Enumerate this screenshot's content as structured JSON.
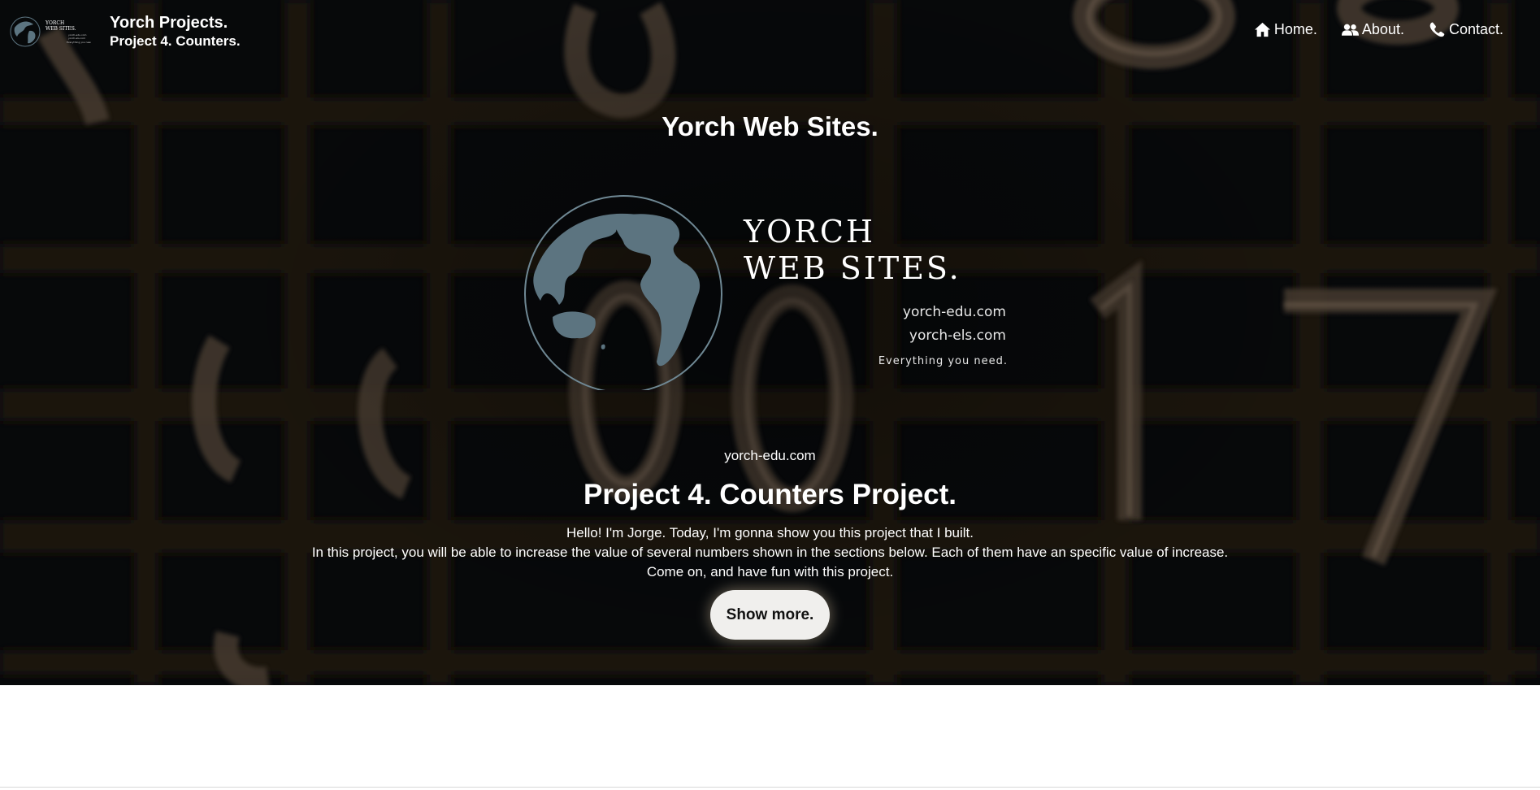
{
  "header": {
    "logo_icon": "yorch-globe-logo",
    "brand_title": "Yorch Projects.",
    "brand_subtitle": "Project 4. Counters."
  },
  "nav": {
    "items": [
      {
        "label": "Home.",
        "icon": "home-icon"
      },
      {
        "label": "About.",
        "icon": "users-icon"
      },
      {
        "label": "Contact.",
        "icon": "phone-icon"
      }
    ]
  },
  "hero": {
    "site_title": "Yorch Web Sites.",
    "logo": {
      "line1": "YORCH",
      "line2": "WEB SITES.",
      "url1": "yorch-edu.com",
      "url2": "yorch-els.com",
      "tagline": "Everything you need."
    },
    "domain": "yorch-edu.com",
    "project_title": "Project 4. Counters Project.",
    "intro_lines": [
      "Hello! I'm Jorge. Today, I'm gonna show you this project that I built.",
      "In this project, you will be able to increase the value of several numbers shown in the sections below. Each of them have an specific value of increase.",
      "Come on, and have fun with this project."
    ],
    "show_more_label": "Show more."
  },
  "colors": {
    "hero_background": "#07090b",
    "text": "#ffffff",
    "globe": "#5c7480",
    "button_background": "#f0efed",
    "button_text": "#111111"
  }
}
